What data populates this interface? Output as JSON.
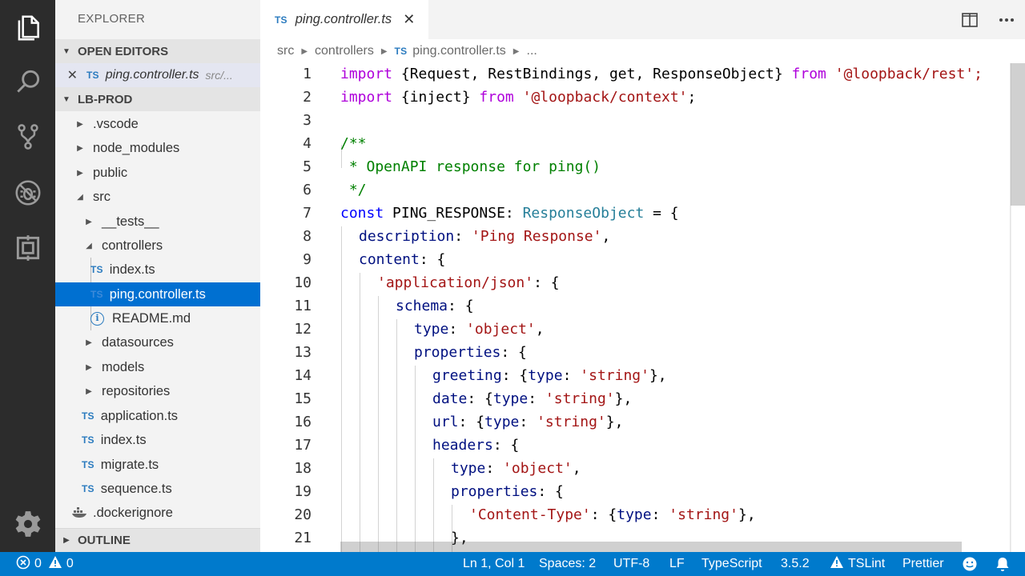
{
  "sidebar": {
    "title": "EXPLORER",
    "open_editors_label": "OPEN EDITORS",
    "open_editor": {
      "badge": "TS",
      "name": "ping.controller.ts",
      "path": "src/..."
    },
    "project_label": "LB-PROD",
    "outline_label": "OUTLINE",
    "tree": [
      {
        "label": ".vscode"
      },
      {
        "label": "node_modules"
      },
      {
        "label": "public"
      },
      {
        "label": "src"
      },
      {
        "label": "__tests__"
      },
      {
        "label": "controllers"
      },
      {
        "label": "index.ts",
        "badge": "TS"
      },
      {
        "label": "ping.controller.ts",
        "badge": "TS"
      },
      {
        "label": "README.md",
        "badge": "i"
      },
      {
        "label": "datasources"
      },
      {
        "label": "models"
      },
      {
        "label": "repositories"
      },
      {
        "label": "application.ts",
        "badge": "TS"
      },
      {
        "label": "index.ts",
        "badge": "TS"
      },
      {
        "label": "migrate.ts",
        "badge": "TS"
      },
      {
        "label": "sequence.ts",
        "badge": "TS"
      },
      {
        "label": ".dockerignore"
      }
    ]
  },
  "tab": {
    "badge": "TS",
    "name": "ping.controller.ts",
    "close": "✕"
  },
  "breadcrumb": {
    "items": [
      "src",
      "controllers"
    ],
    "file_badge": "TS",
    "file": "ping.controller.ts",
    "ellipsis": "..."
  },
  "editor": {
    "lines": [
      "1",
      "2",
      "3",
      "4",
      "5",
      "6",
      "7",
      "8",
      "9",
      "10",
      "11",
      "12",
      "13",
      "14",
      "15",
      "16",
      "17",
      "18",
      "19",
      "20",
      "21"
    ],
    "code": {
      "l1_import": "import",
      "l1_a": " {Request, RestBindings, get, ResponseObject} ",
      "l1_from": "from",
      "l1_sp": " ",
      "l1_str": "'@loopback/rest';",
      "l2_import": "import",
      "l2_a": " {inject} ",
      "l2_from": "from",
      "l2_sp": " ",
      "l2_str": "'@loopback/context'",
      "l2_end": ";",
      "l4": "/**",
      "l5": " * OpenAPI response for ping()",
      "l6": " */",
      "l7_const": "const",
      "l7_a": " PING_RESPONSE: ",
      "l7_type": "ResponseObject",
      "l7_b": " = {",
      "l8_prop": "description",
      "l8_a": ": ",
      "l8_str": "'Ping Response'",
      "l8_b": ",",
      "l9_prop": "content",
      "l9_a": ": {",
      "l10_str": "'application/json'",
      "l10_a": ": {",
      "l11_prop": "schema",
      "l11_a": ": {",
      "l12_prop": "type",
      "l12_a": ": ",
      "l12_str": "'object'",
      "l12_b": ",",
      "l13_prop": "properties",
      "l13_a": ": {",
      "l14_prop": "greeting",
      "l14_a": ": {",
      "l14_prop2": "type",
      "l14_b": ": ",
      "l14_str": "'string'",
      "l14_c": "},",
      "l15_prop": "date",
      "l15_a": ": {",
      "l15_prop2": "type",
      "l15_b": ": ",
      "l15_str": "'string'",
      "l15_c": "},",
      "l16_prop": "url",
      "l16_a": ": {",
      "l16_prop2": "type",
      "l16_b": ": ",
      "l16_str": "'string'",
      "l16_c": "},",
      "l17_prop": "headers",
      "l17_a": ": {",
      "l18_prop": "type",
      "l18_a": ": ",
      "l18_str": "'object'",
      "l18_b": ",",
      "l19_prop": "properties",
      "l19_a": ": {",
      "l20_str": "'Content-Type'",
      "l20_a": ": {",
      "l20_prop2": "type",
      "l20_b": ": ",
      "l20_str2": "'string'",
      "l20_c": "},",
      "l21": "},"
    }
  },
  "statusbar": {
    "errors": "0",
    "warnings": "0",
    "position": "Ln 1, Col 1",
    "spaces": "Spaces: 2",
    "encoding": "UTF-8",
    "eol": "LF",
    "language": "TypeScript",
    "version": "3.5.2",
    "tslint": "TSLint",
    "prettier": "Prettier"
  },
  "colors": {
    "accent": "#007acc",
    "selection": "#0070d1",
    "activity_bar": "#2c2c2c"
  },
  "icons": [
    "files-icon",
    "search-icon",
    "source-control-icon",
    "debug-icon",
    "extensions-icon",
    "gear-icon",
    "split-editor-icon",
    "more-icon",
    "error-icon",
    "warning-icon",
    "smiley-icon",
    "bell-icon"
  ]
}
